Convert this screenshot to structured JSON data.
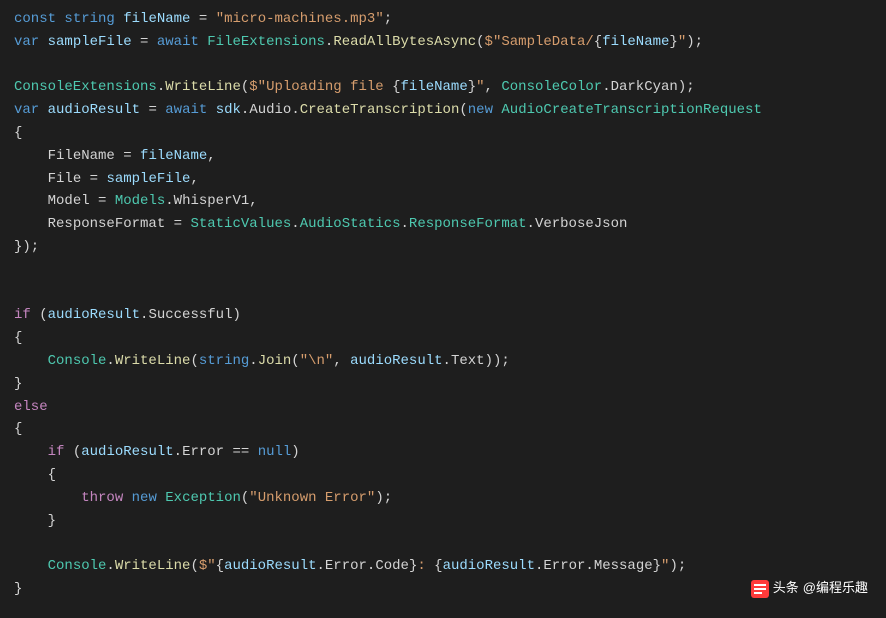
{
  "code": {
    "l1": {
      "const": "const",
      "string_t": "string",
      "fileName": "fileName",
      "eq": " = ",
      "val": "\"micro-machines.mp3\"",
      "semi": ";"
    },
    "l2": {
      "var": "var",
      "sampleFile": "sampleFile",
      "eq": " = ",
      "await": "await",
      "FileExtensions": "FileExtensions",
      "dot": ".",
      "ReadAllBytesAsync": "ReadAllBytesAsync",
      "open": "(",
      "interp_start": "$\"",
      "str1": "SampleData/",
      "brace_open": "{",
      "fileName2": "fileName",
      "brace_close": "}",
      "interp_end": "\"",
      "close": ")",
      "semi": ";"
    },
    "l4": {
      "ConsoleExtensions": "ConsoleExtensions",
      "dot": ".",
      "WriteLine": "WriteLine",
      "open": "(",
      "interp_start": "$\"",
      "str1": "Uploading file ",
      "brace_open": "{",
      "fileName": "fileName",
      "brace_close": "}",
      "interp_end": "\"",
      "comma": ", ",
      "ConsoleColor": "ConsoleColor",
      "dot2": ".",
      "DarkCyan": "DarkCyan",
      "close": ")",
      "semi": ";"
    },
    "l5": {
      "var": "var",
      "audioResult": "audioResult",
      "eq": " = ",
      "await": "await",
      "sdk": "sdk",
      "dot": ".",
      "Audio": "Audio",
      "dot2": ".",
      "CreateTranscription": "CreateTranscription",
      "open": "(",
      "new": "new",
      "AudioCreateTranscriptionRequest": "AudioCreateTranscriptionRequest"
    },
    "l6": {
      "brace": "{"
    },
    "l7": {
      "indent": "    ",
      "FileName": "FileName",
      "eq": " = ",
      "fileName": "fileName",
      "comma": ","
    },
    "l8": {
      "indent": "    ",
      "File": "File",
      "eq": " = ",
      "sampleFile": "sampleFile",
      "comma": ","
    },
    "l9": {
      "indent": "    ",
      "Model": "Model",
      "eq": " = ",
      "Models": "Models",
      "dot": ".",
      "WhisperV1": "WhisperV1",
      "comma": ","
    },
    "l10": {
      "indent": "    ",
      "ResponseFormat": "ResponseFormat",
      "eq": " = ",
      "StaticValues": "StaticValues",
      "dot": ".",
      "AudioStatics": "AudioStatics",
      "dot2": ".",
      "ResponseFormat2": "ResponseFormat",
      "dot3": ".",
      "VerboseJson": "VerboseJson"
    },
    "l11": {
      "close": "});"
    },
    "l14": {
      "if": "if",
      "open": " (",
      "audioResult": "audioResult",
      "dot": ".",
      "Successful": "Successful",
      "close": ")"
    },
    "l15": {
      "brace": "{"
    },
    "l16": {
      "indent": "    ",
      "Console": "Console",
      "dot": ".",
      "WriteLine": "WriteLine",
      "open": "(",
      "string_t": "string",
      "dot2": ".",
      "Join": "Join",
      "open2": "(",
      "newline": "\"\\n\"",
      "comma": ", ",
      "audioResult": "audioResult",
      "dot3": ".",
      "Text": "Text",
      "close": "));"
    },
    "l17": {
      "brace": "}"
    },
    "l18": {
      "else": "else"
    },
    "l19": {
      "brace": "{"
    },
    "l20": {
      "indent": "    ",
      "if": "if",
      "open": " (",
      "audioResult": "audioResult",
      "dot": ".",
      "Error": "Error",
      "eq": " == ",
      "null": "null",
      "close": ")"
    },
    "l21": {
      "indent": "    ",
      "brace": "{"
    },
    "l22": {
      "indent": "        ",
      "throw": "throw",
      "sp": " ",
      "new": "new",
      "sp2": " ",
      "Exception": "Exception",
      "open": "(",
      "msg": "\"Unknown Error\"",
      "close": ");"
    },
    "l23": {
      "indent": "    ",
      "brace": "}"
    },
    "l25": {
      "indent": "    ",
      "Console": "Console",
      "dot": ".",
      "WriteLine": "WriteLine",
      "open": "(",
      "interp_start": "$\"",
      "brace_open": "{",
      "audioResult": "audioResult",
      "dot2": ".",
      "Error": "Error",
      "dot3": ".",
      "Code": "Code",
      "brace_close": "}",
      "colon": ": ",
      "brace_open2": "{",
      "audioResult2": "audioResult",
      "dot4": ".",
      "Error2": "Error",
      "dot5": ".",
      "Message": "Message",
      "brace_close2": "}",
      "interp_end": "\"",
      "close": ");"
    },
    "l26": {
      "brace": "}"
    }
  },
  "watermark": {
    "prefix": "头条",
    "handle": "@编程乐趣"
  }
}
